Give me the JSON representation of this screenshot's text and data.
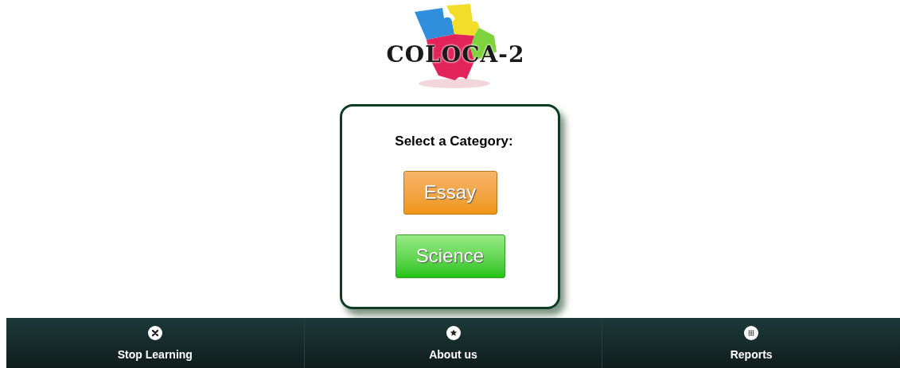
{
  "logo": {
    "text": "COLOCA-2"
  },
  "panel": {
    "heading": "Select a Category:",
    "buttons": [
      {
        "label": "Essay",
        "kind": "orange"
      },
      {
        "label": "Science",
        "kind": "green"
      }
    ]
  },
  "footer": {
    "tabs": [
      {
        "label": "Stop Learning",
        "kind": "close"
      },
      {
        "label": "About us",
        "kind": "star"
      },
      {
        "label": "Reports",
        "kind": "grid"
      }
    ]
  }
}
